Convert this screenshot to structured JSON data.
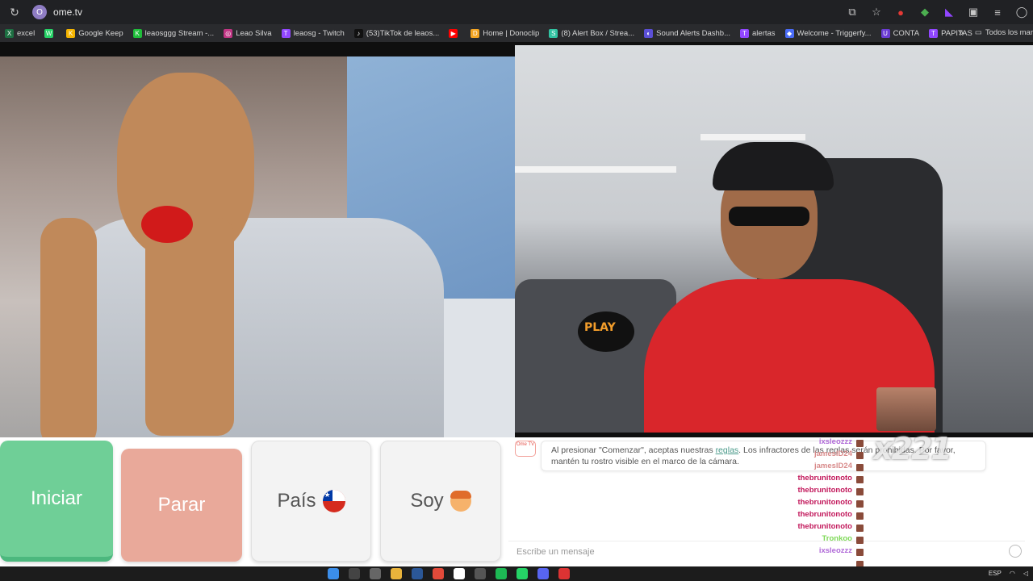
{
  "browser": {
    "url": "ome.tv",
    "site_badge": "O"
  },
  "bookmarks": [
    {
      "label": "excel",
      "color": "#1d6f42",
      "glyph": "X"
    },
    {
      "label": "",
      "color": "#25d366",
      "glyph": "W"
    },
    {
      "label": "Google Keep",
      "color": "#f4b400",
      "glyph": "K"
    },
    {
      "label": "leaosggg Stream -...",
      "color": "#1fbd3a",
      "glyph": "K"
    },
    {
      "label": "Leao Silva",
      "color": "#c13584",
      "glyph": "◎"
    },
    {
      "label": "leaosg - Twitch",
      "color": "#9146ff",
      "glyph": "T"
    },
    {
      "label": "(53)TikTok de leaos...",
      "color": "#111111",
      "glyph": "♪"
    },
    {
      "label": "",
      "color": "#ff0000",
      "glyph": "▶"
    },
    {
      "label": "Home | Donoclip",
      "color": "#f5a623",
      "glyph": "D"
    },
    {
      "label": "(8) Alert Box / Strea...",
      "color": "#31c3a2",
      "glyph": "S"
    },
    {
      "label": "Sound Alerts Dashb...",
      "color": "#5b4fd6",
      "glyph": "◐"
    },
    {
      "label": "alertas",
      "color": "#9146ff",
      "glyph": "T"
    },
    {
      "label": "Welcome - Triggerfy...",
      "color": "#4a6cf7",
      "glyph": "◆"
    },
    {
      "label": "CONTA",
      "color": "#6a3bd4",
      "glyph": "U"
    },
    {
      "label": "PAPITAS",
      "color": "#9146ff",
      "glyph": "T"
    }
  ],
  "bookmarks_more": "»",
  "bookmarks_folder": "Todos los mar",
  "overlay": {
    "pillow_text": "PLAY",
    "meme_text": "x221"
  },
  "controls": {
    "start_label": "Iniciar",
    "stop_label": "Parar",
    "country_label": "País",
    "self_label": "Soy"
  },
  "chat": {
    "logo_text": "Ome TV",
    "notice_before": "Al presionar \"Comenzar\", aceptas nuestras ",
    "notice_link": "reglas",
    "notice_after": ". Los infractores de las reglas serán prohibidas. Por favor, mantén tu rostro visible en el marco de la cámara.",
    "input_placeholder": "Escribe un mensaje"
  },
  "stream_chat": [
    {
      "name": "ixsleozzz",
      "color": "#b06ad8"
    },
    {
      "name": "jameslD24",
      "color": "#d88a8a"
    },
    {
      "name": "jameslD24",
      "color": "#d88a8a"
    },
    {
      "name": "thebrunitonoto",
      "color": "#c2185b"
    },
    {
      "name": "thebrunitonoto",
      "color": "#c2185b"
    },
    {
      "name": "thebrunitonoto",
      "color": "#c2185b"
    },
    {
      "name": "thebrunitonoto",
      "color": "#c2185b"
    },
    {
      "name": "thebrunitonoto",
      "color": "#c2185b"
    },
    {
      "name": "Tronkoo",
      "color": "#7ed957"
    },
    {
      "name": "ixsleozzz",
      "color": "#b06ad8"
    },
    {
      "name": "Baxturns",
      "color": "#ffffff"
    }
  ],
  "taskbar": {
    "lang": "ESP"
  },
  "colors": {
    "start_green": "#6fcf97",
    "stop_salmon": "#e9a99a",
    "link_teal": "#4a9a8a"
  }
}
